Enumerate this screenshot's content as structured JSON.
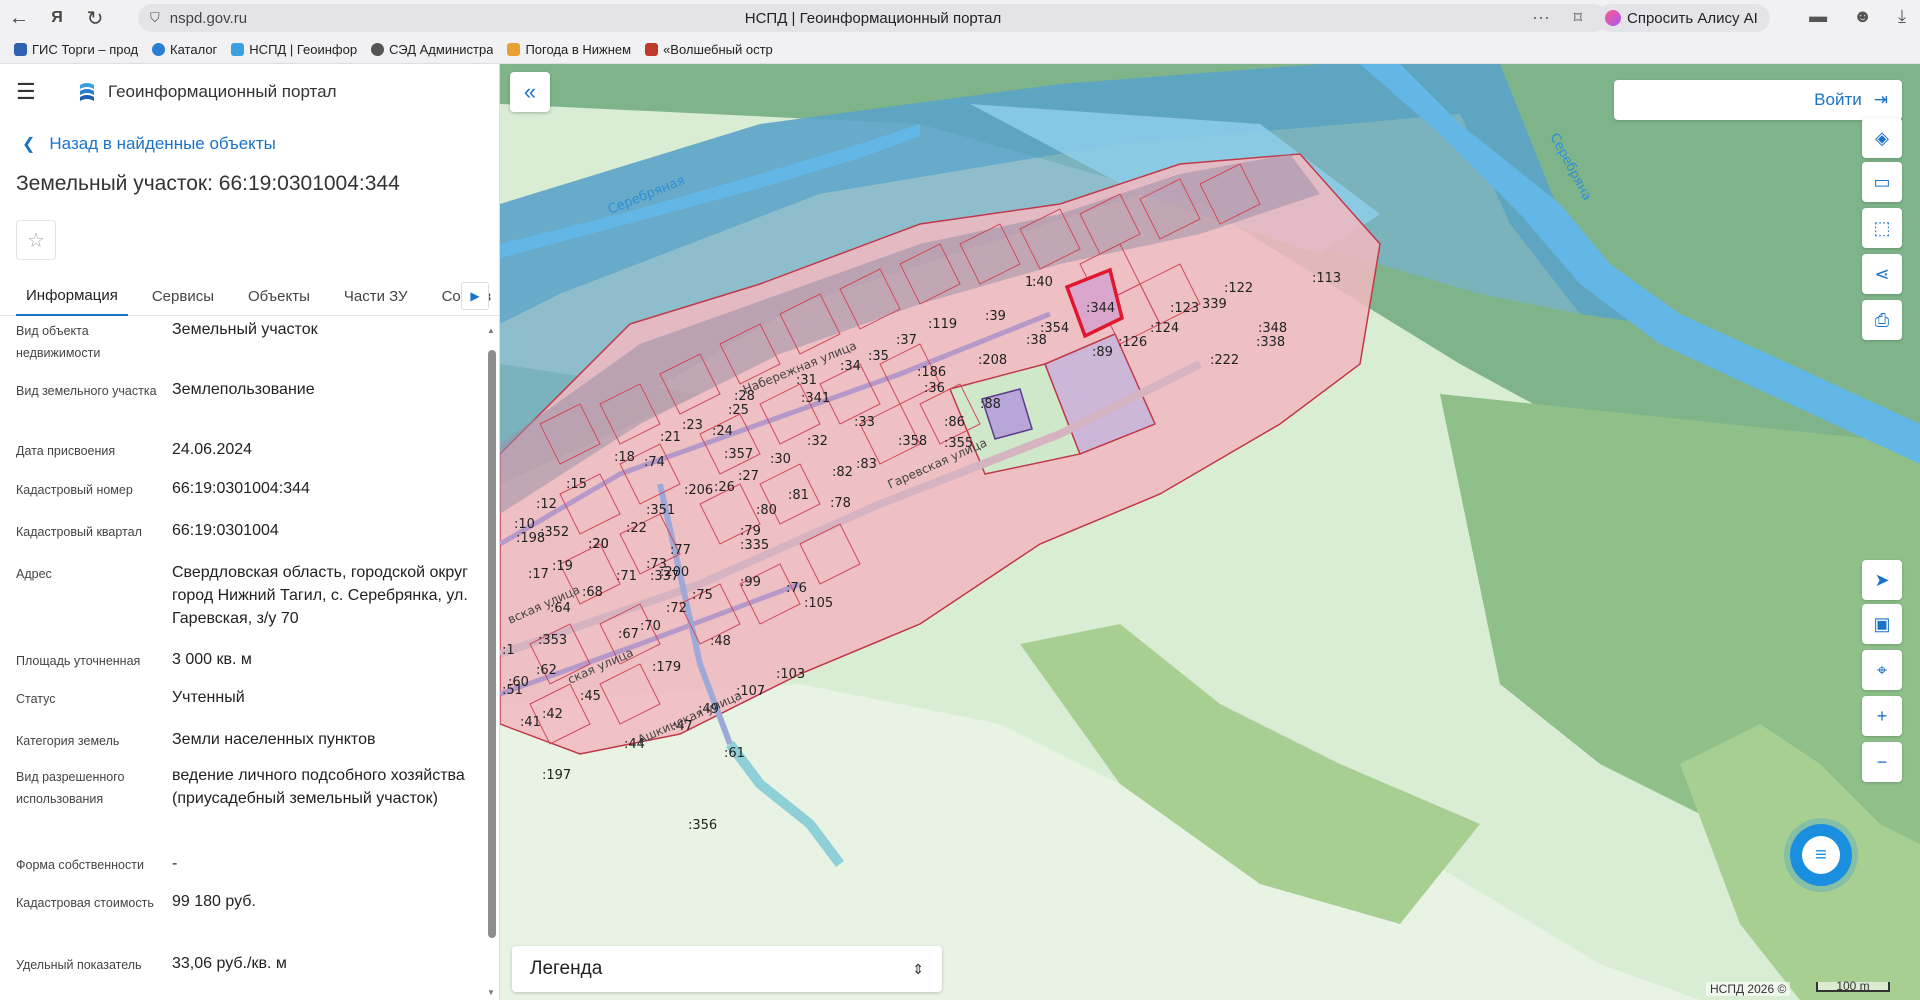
{
  "browser": {
    "url": "nspd.gov.ru",
    "tab_title": "НСПД | Геоинформационный портал",
    "alice_label": "Спросить Алису AI",
    "bookmarks": [
      {
        "label": "ГИС Торги – прод",
        "color": "#3060b0"
      },
      {
        "label": "Каталог",
        "color": "#2a7fd4"
      },
      {
        "label": "НСПД | Геоинфор",
        "color": "#3aa0e0"
      },
      {
        "label": "СЭД Администра",
        "color": "#555555"
      },
      {
        "label": "Погода в Нижнем",
        "color": "#e8a030"
      },
      {
        "label": "«Волшебный остр",
        "color": "#c0392b"
      }
    ]
  },
  "panel": {
    "portal_name": "Геоинформационный портал",
    "back_label": "Назад в найденные объекты",
    "object_title": "Земельный участок: 66:19:0301004:344",
    "tabs": [
      "Информация",
      "Сервисы",
      "Объекты",
      "Части ЗУ",
      "Состав"
    ],
    "fields": [
      {
        "label": "Вид объекта недвижимости",
        "value": "Земельный участок"
      },
      {
        "label": "Вид земельного участка",
        "value": "Землепользование"
      },
      {
        "label": "Дата присвоения",
        "value": "24.06.2024"
      },
      {
        "label": "Кадастровый номер",
        "value": "66:19:0301004:344"
      },
      {
        "label": "Кадастровый квартал",
        "value": "66:19:0301004"
      },
      {
        "label": "Адрес",
        "value": "Свердловская область, городской округ город Нижний Тагил, с. Серебрянка, ул. Гаревская, з/у 70"
      },
      {
        "label": "Площадь уточненная",
        "value": "3 000 кв. м"
      },
      {
        "label": "Статус",
        "value": "Учтенный"
      },
      {
        "label": "Категория земель",
        "value": "Земли населенных пунктов"
      },
      {
        "label": "Вид разрешенного использования",
        "value": "ведение личного подсобного хозяйства (приусадебный земельный участок)"
      },
      {
        "label": "Форма собственности",
        "value": "-"
      },
      {
        "label": "Кадастровая стоимость",
        "value": "99 180 руб."
      },
      {
        "label": "Удельный показатель",
        "value": "33,06 руб./кв. м"
      }
    ]
  },
  "map": {
    "login_label": "Войти",
    "legend_label": "Легенда",
    "copyright": "НСПД 2026 ©",
    "scale_label": "100 m",
    "street_labels": [
      "Набережная улица",
      "Гаревская улица",
      "Ашкинская улица",
      "вская улица",
      "ская улица"
    ],
    "water_labels": [
      "Серебряная",
      "Серебряна"
    ],
    "parcel_labels": [
      ":40",
      "1",
      ":113",
      ":122",
      "339",
      ":123",
      ":124",
      ":348",
      ":338",
      ":89",
      ":126",
      ":222",
      ":39",
      ":119",
      ":37",
      ":38",
      ":208",
      ":34",
      ":35",
      ":186",
      ":36",
      ":344",
      ":354",
      ":31",
      ":341",
      ":28",
      ":25",
      ":88",
      ":33",
      ":86",
      ":358",
      ":355",
      ":23",
      ":24",
      ":21",
      ":32",
      ":357",
      ":30",
      ":18",
      ":74",
      ":27",
      ":83",
      ":82",
      ":26",
      ":206",
      ":81",
      ":80",
      ":15",
      ":12",
      ":351",
      ":20",
      ":22",
      ":79",
      ":335",
      ":78",
      ":76",
      ":10",
      ":198",
      ":352",
      ":77",
      ":20",
      ":19",
      ":73",
      ":337",
      ":71",
      ":17",
      ":99",
      ":200",
      ":68",
      ":75",
      ":105",
      ":64",
      ":72",
      ":70",
      ":67",
      ":353",
      ":48",
      ":62",
      ":179",
      ":45",
      ":103",
      ":107",
      ":60",
      ":49",
      ":42",
      ":47",
      ":41",
      ":44",
      ":51",
      ":197",
      ":356",
      ":61",
      ":1"
    ],
    "selected_parcel": ":344"
  }
}
